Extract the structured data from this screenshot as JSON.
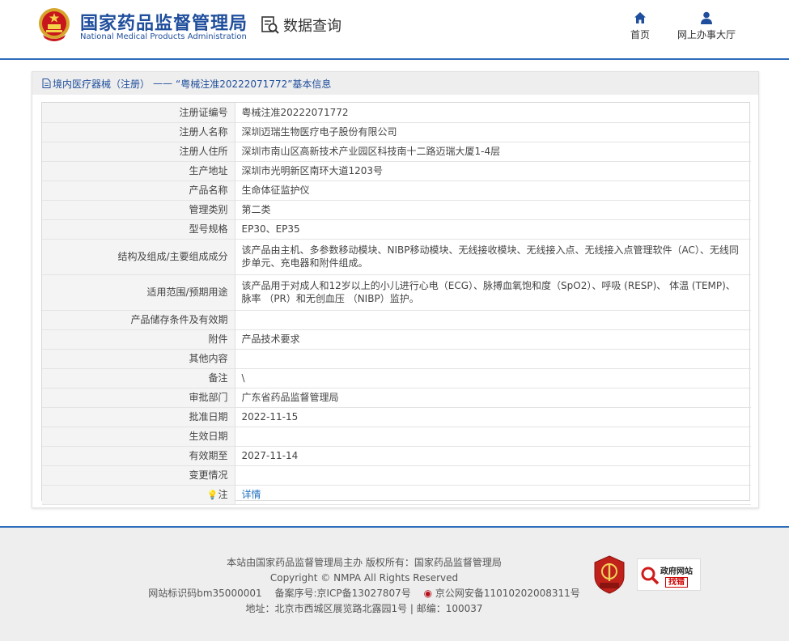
{
  "header": {
    "brand_cn": "国家药品监督管理局",
    "brand_en": "National Medical Products Administration",
    "query_label": "数据查询",
    "nav": [
      {
        "label": "首页",
        "icon": "home-icon"
      },
      {
        "label": "网上办事大厅",
        "icon": "user-icon"
      }
    ]
  },
  "panel": {
    "breadcrumb_prefix": "境内医疗器械（注册）",
    "breadcrumb_dash": "——",
    "breadcrumb_title": "“粤械注准20222071772”基本信息",
    "rows": [
      {
        "key": "注册证编号",
        "value": "粤械注准20222071772"
      },
      {
        "key": "注册人名称",
        "value": "深圳迈瑞生物医疗电子股份有限公司"
      },
      {
        "key": "注册人住所",
        "value": "深圳市南山区高新技术产业园区科技南十二路迈瑞大厦1-4层"
      },
      {
        "key": "生产地址",
        "value": "深圳市光明新区南环大道1203号"
      },
      {
        "key": "产品名称",
        "value": "生命体征监护仪"
      },
      {
        "key": "管理类别",
        "value": "第二类"
      },
      {
        "key": "型号规格",
        "value": "EP30、EP35"
      },
      {
        "key": "结构及组成/主要组成成分",
        "value": "该产品由主机、多参数移动模块、NIBP移动模块、无线接收模块、无线接入点、无线接入点管理软件（AC）、无线同步单元、充电器和附件组成。"
      },
      {
        "key": "适用范围/预期用途",
        "value": "该产品用于对成人和12岁以上的小儿进行心电（ECG）、脉搏血氧饱和度（SpO2）、呼吸 (RESP)、 体温 (TEMP)、脉率 （PR）和无创血压 （NIBP）监护。"
      },
      {
        "key": "产品储存条件及有效期",
        "value": ""
      },
      {
        "key": "附件",
        "value": "产品技术要求"
      },
      {
        "key": "其他内容",
        "value": ""
      },
      {
        "key": "备注",
        "value": "\\"
      },
      {
        "key": "审批部门",
        "value": "广东省药品监督管理局"
      },
      {
        "key": "批准日期",
        "value": "2022-11-15"
      },
      {
        "key": "生效日期",
        "value": ""
      },
      {
        "key": "有效期至",
        "value": "2027-11-14"
      },
      {
        "key": "变更情况",
        "value": ""
      }
    ],
    "note_key": "注",
    "note_link": "详情"
  },
  "footer": {
    "line1": "本站由国家药品监督管理局主办 版权所有：国家药品监督管理局",
    "line2": "Copyright © NMPA All Rights Reserved",
    "site_id": "网站标识码bm35000001",
    "icp": "备案序号:京ICP备13027807号",
    "police": "京公网安备11010202008311号",
    "address": "地址：北京市西城区展览路北露园1号 | 邮编：100037",
    "badge2_top": "政府网站",
    "badge2_bottom": "找错"
  },
  "colors": {
    "brand_blue": "#1f4e9c",
    "link_blue": "#1f6fc0",
    "rule_blue": "#2e6dbb"
  }
}
